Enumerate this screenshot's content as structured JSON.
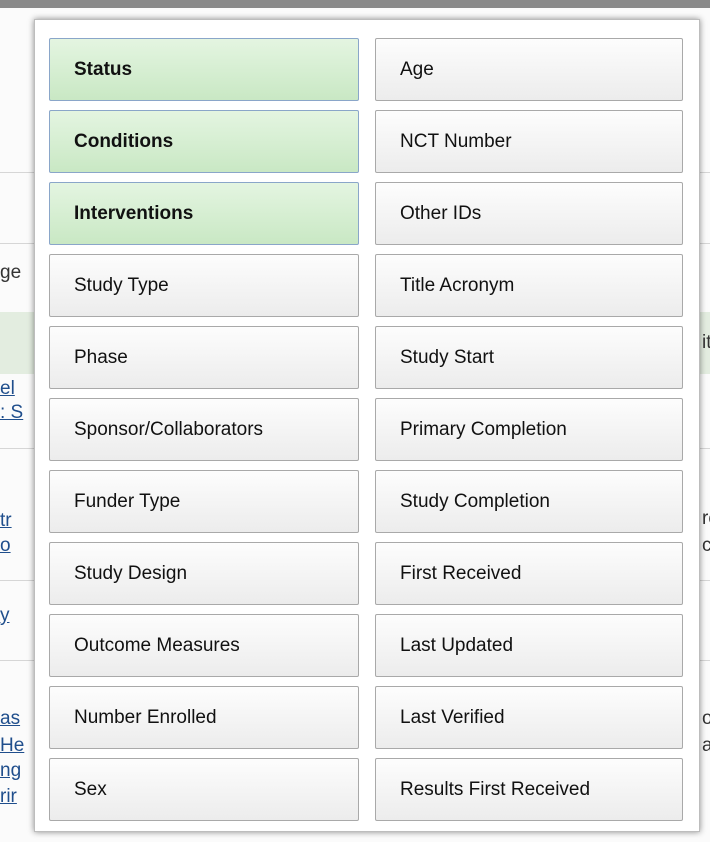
{
  "background_fragments": {
    "row1": "ge",
    "row2": "el",
    "row3": ": S",
    "row4": "tr",
    "row5": "o",
    "row6": "y",
    "row7": "as",
    "row8": "He",
    "row9": "ng",
    "row10": "rir",
    "right1": "it",
    "right2": "re",
    "right3": "c",
    "right4": "or",
    "right5": "a"
  },
  "column_options": [
    {
      "label": "Status",
      "selected": true
    },
    {
      "label": "Age",
      "selected": false
    },
    {
      "label": "Conditions",
      "selected": true
    },
    {
      "label": "NCT Number",
      "selected": false
    },
    {
      "label": "Interventions",
      "selected": true
    },
    {
      "label": "Other IDs",
      "selected": false
    },
    {
      "label": "Study Type",
      "selected": false
    },
    {
      "label": "Title Acronym",
      "selected": false
    },
    {
      "label": "Phase",
      "selected": false
    },
    {
      "label": "Study Start",
      "selected": false
    },
    {
      "label": "Sponsor/Collaborators",
      "selected": false
    },
    {
      "label": "Primary Completion",
      "selected": false
    },
    {
      "label": "Funder Type",
      "selected": false
    },
    {
      "label": "Study Completion",
      "selected": false
    },
    {
      "label": "Study Design",
      "selected": false
    },
    {
      "label": "First Received",
      "selected": false
    },
    {
      "label": "Outcome Measures",
      "selected": false
    },
    {
      "label": "Last Updated",
      "selected": false
    },
    {
      "label": "Number Enrolled",
      "selected": false
    },
    {
      "label": "Last Verified",
      "selected": false
    },
    {
      "label": "Sex",
      "selected": false
    },
    {
      "label": "Results First Received",
      "selected": false
    }
  ],
  "colors": {
    "selected_bg": "#c9e8c4",
    "unselected_bg": "#ececec",
    "selected_border": "#8aa6c9"
  }
}
